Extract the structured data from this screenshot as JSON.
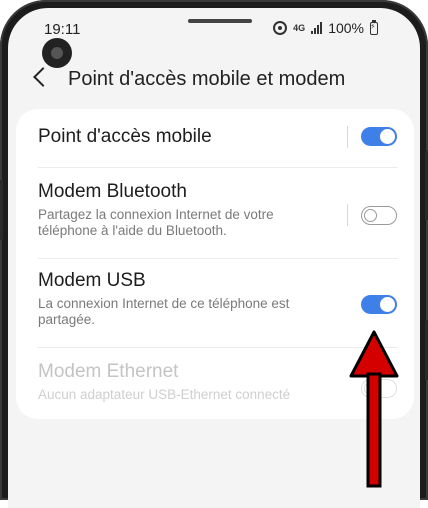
{
  "status_bar": {
    "time": "19:11",
    "network": "4G",
    "battery": "100%"
  },
  "header": {
    "title": "Point d'accès mobile et modem"
  },
  "settings": [
    {
      "title": "Point d'accès mobile",
      "description": "",
      "toggle": "on",
      "enabled": true
    },
    {
      "title": "Modem Bluetooth",
      "description": "Partagez la connexion Internet de votre téléphone à l'aide du Bluetooth.",
      "toggle": "off",
      "enabled": true
    },
    {
      "title": "Modem USB",
      "description": "La connexion Internet de ce téléphone est partagée.",
      "toggle": "on",
      "enabled": true
    },
    {
      "title": "Modem Ethernet",
      "description": "Aucun adaptateur USB-Ethernet connecté",
      "toggle": "off",
      "enabled": false
    }
  ],
  "colors": {
    "accent": "#3e80e8",
    "annotation_arrow": "#d40000"
  },
  "icons": {
    "back": "chevron-left-icon",
    "hotspot": "hotspot-icon",
    "signal": "signal-icon",
    "battery": "battery-charging-icon"
  }
}
